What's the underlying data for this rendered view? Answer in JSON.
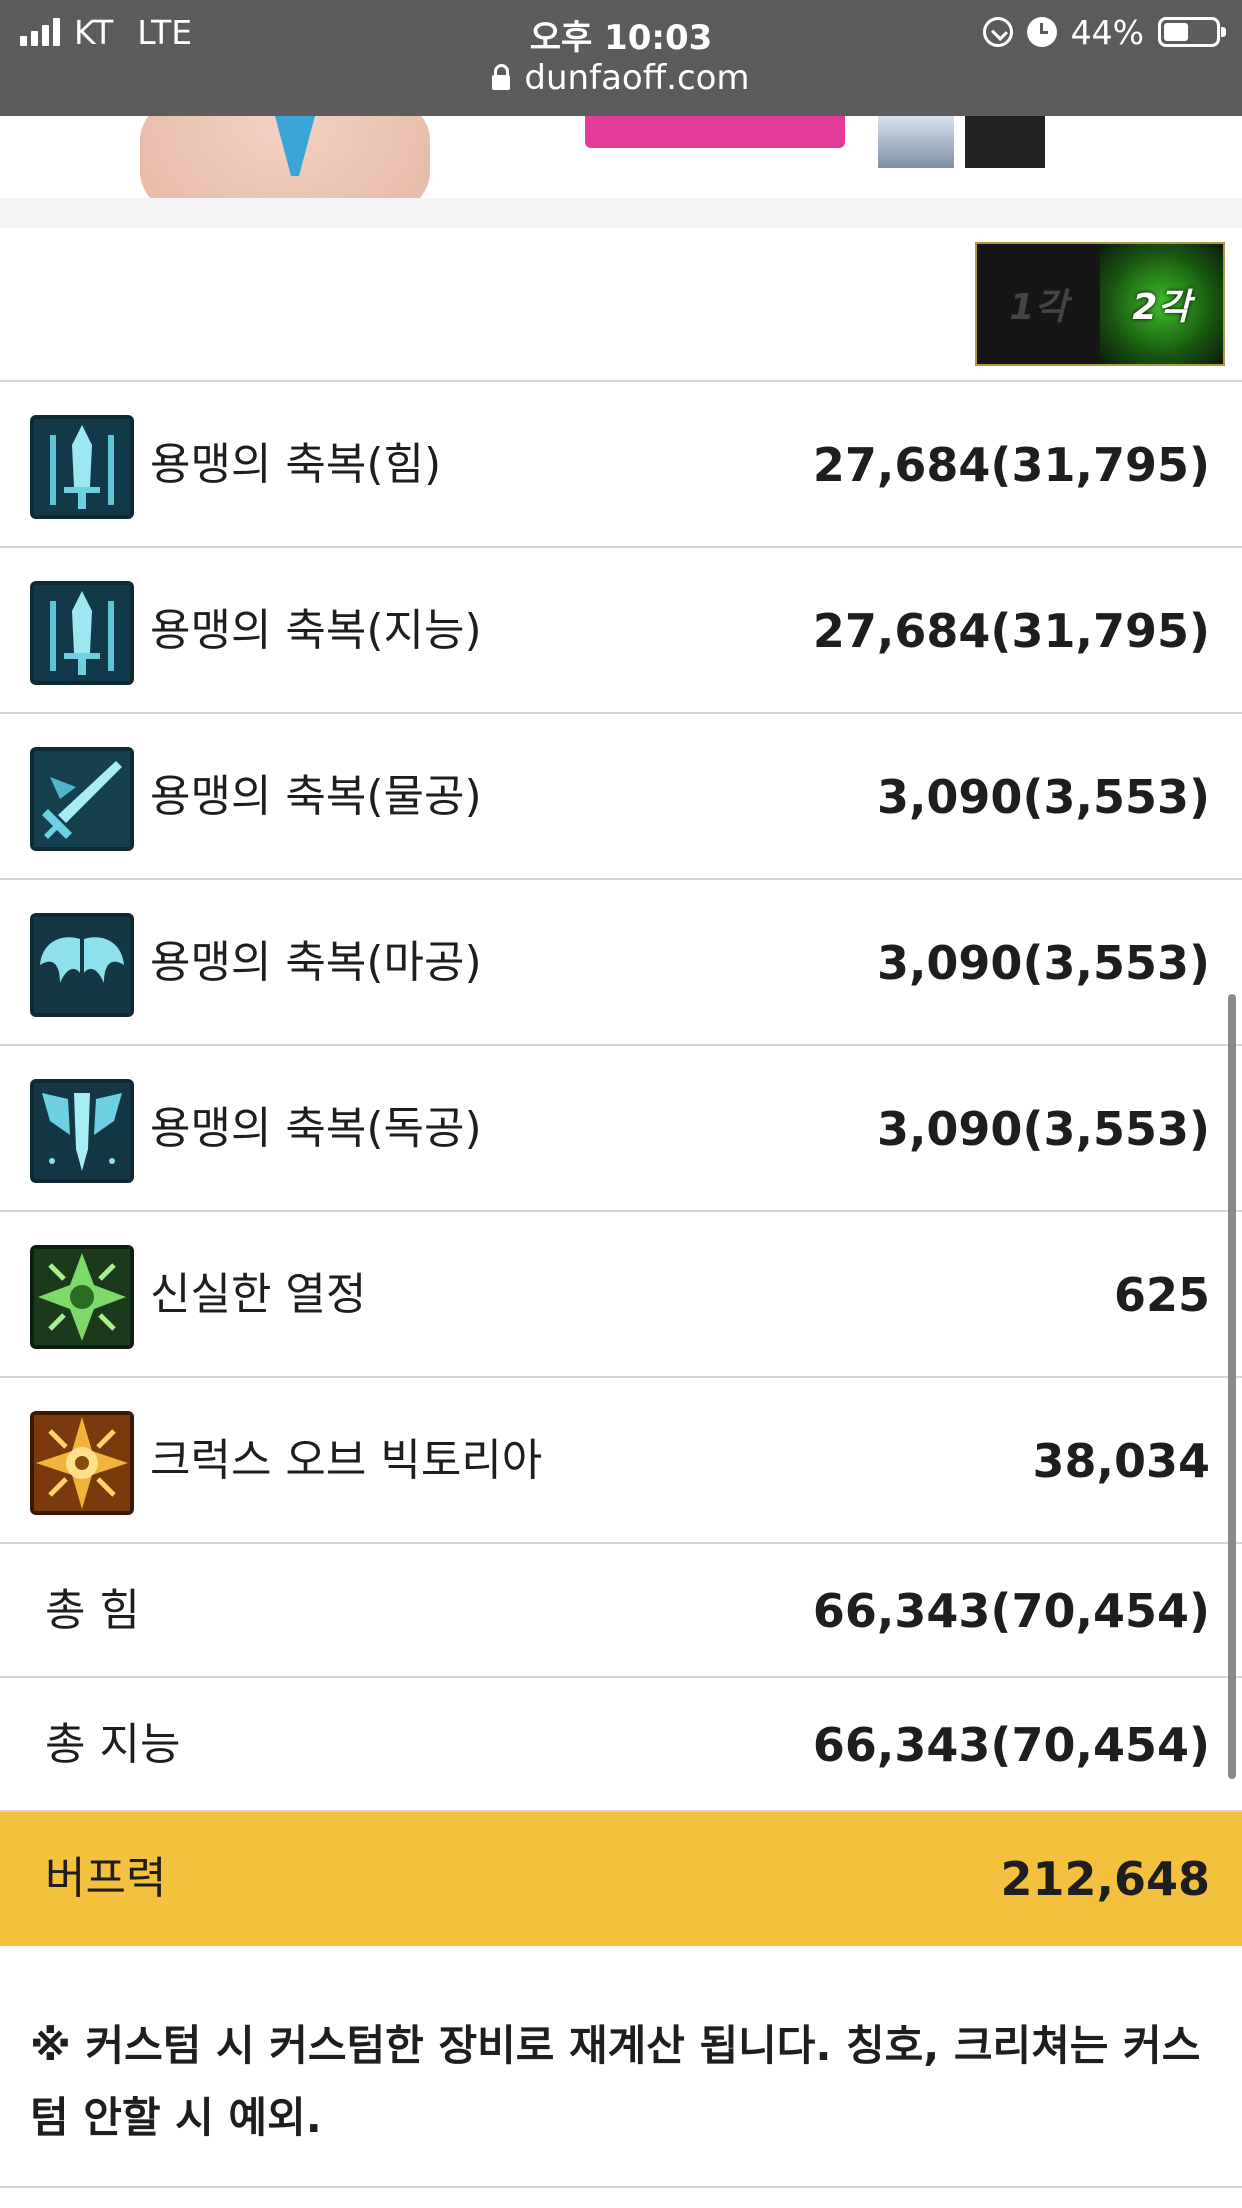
{
  "status_bar": {
    "carrier": "KT",
    "network": "LTE",
    "time": "오후 10:03",
    "battery": "44%",
    "battery_level": 0.44,
    "url": "dunfaoff.com"
  },
  "awakening_selector": {
    "options": [
      "1각",
      "2각"
    ],
    "selected": "2각"
  },
  "buff_rows": [
    {
      "name": "용맹의 축복(힘)",
      "value": "27,684(31,795)",
      "icon": "sword-blessing-icon"
    },
    {
      "name": "용맹의 축복(지능)",
      "value": "27,684(31,795)",
      "icon": "sword-blessing-icon"
    },
    {
      "name": "용맹의 축복(물공)",
      "value": "3,090(3,553)",
      "icon": "crossed-sword-icon"
    },
    {
      "name": "용맹의 축복(마공)",
      "value": "3,090(3,553)",
      "icon": "wings-icon"
    },
    {
      "name": "용맹의 축복(독공)",
      "value": "3,090(3,553)",
      "icon": "winged-sword-icon"
    },
    {
      "name": "신실한 열정",
      "value": "625",
      "icon": "green-cross-icon"
    },
    {
      "name": "크럭스 오브 빅토리아",
      "value": "38,034",
      "icon": "golden-emblem-icon"
    }
  ],
  "totals": [
    {
      "name": "총 힘",
      "value": "66,343(70,454)"
    },
    {
      "name": "총 지능",
      "value": "66,343(70,454)"
    }
  ],
  "buff_power": {
    "name": "버프력",
    "value": "212,648"
  },
  "note": "※ 커스텀 시 커스텀한 장비로 재계산 됩니다. 칭호, 크리쳐는 커스텀 안할 시 예외.",
  "colors": {
    "highlight": "#f4c13f",
    "statusbar": "#5c5c5c"
  }
}
